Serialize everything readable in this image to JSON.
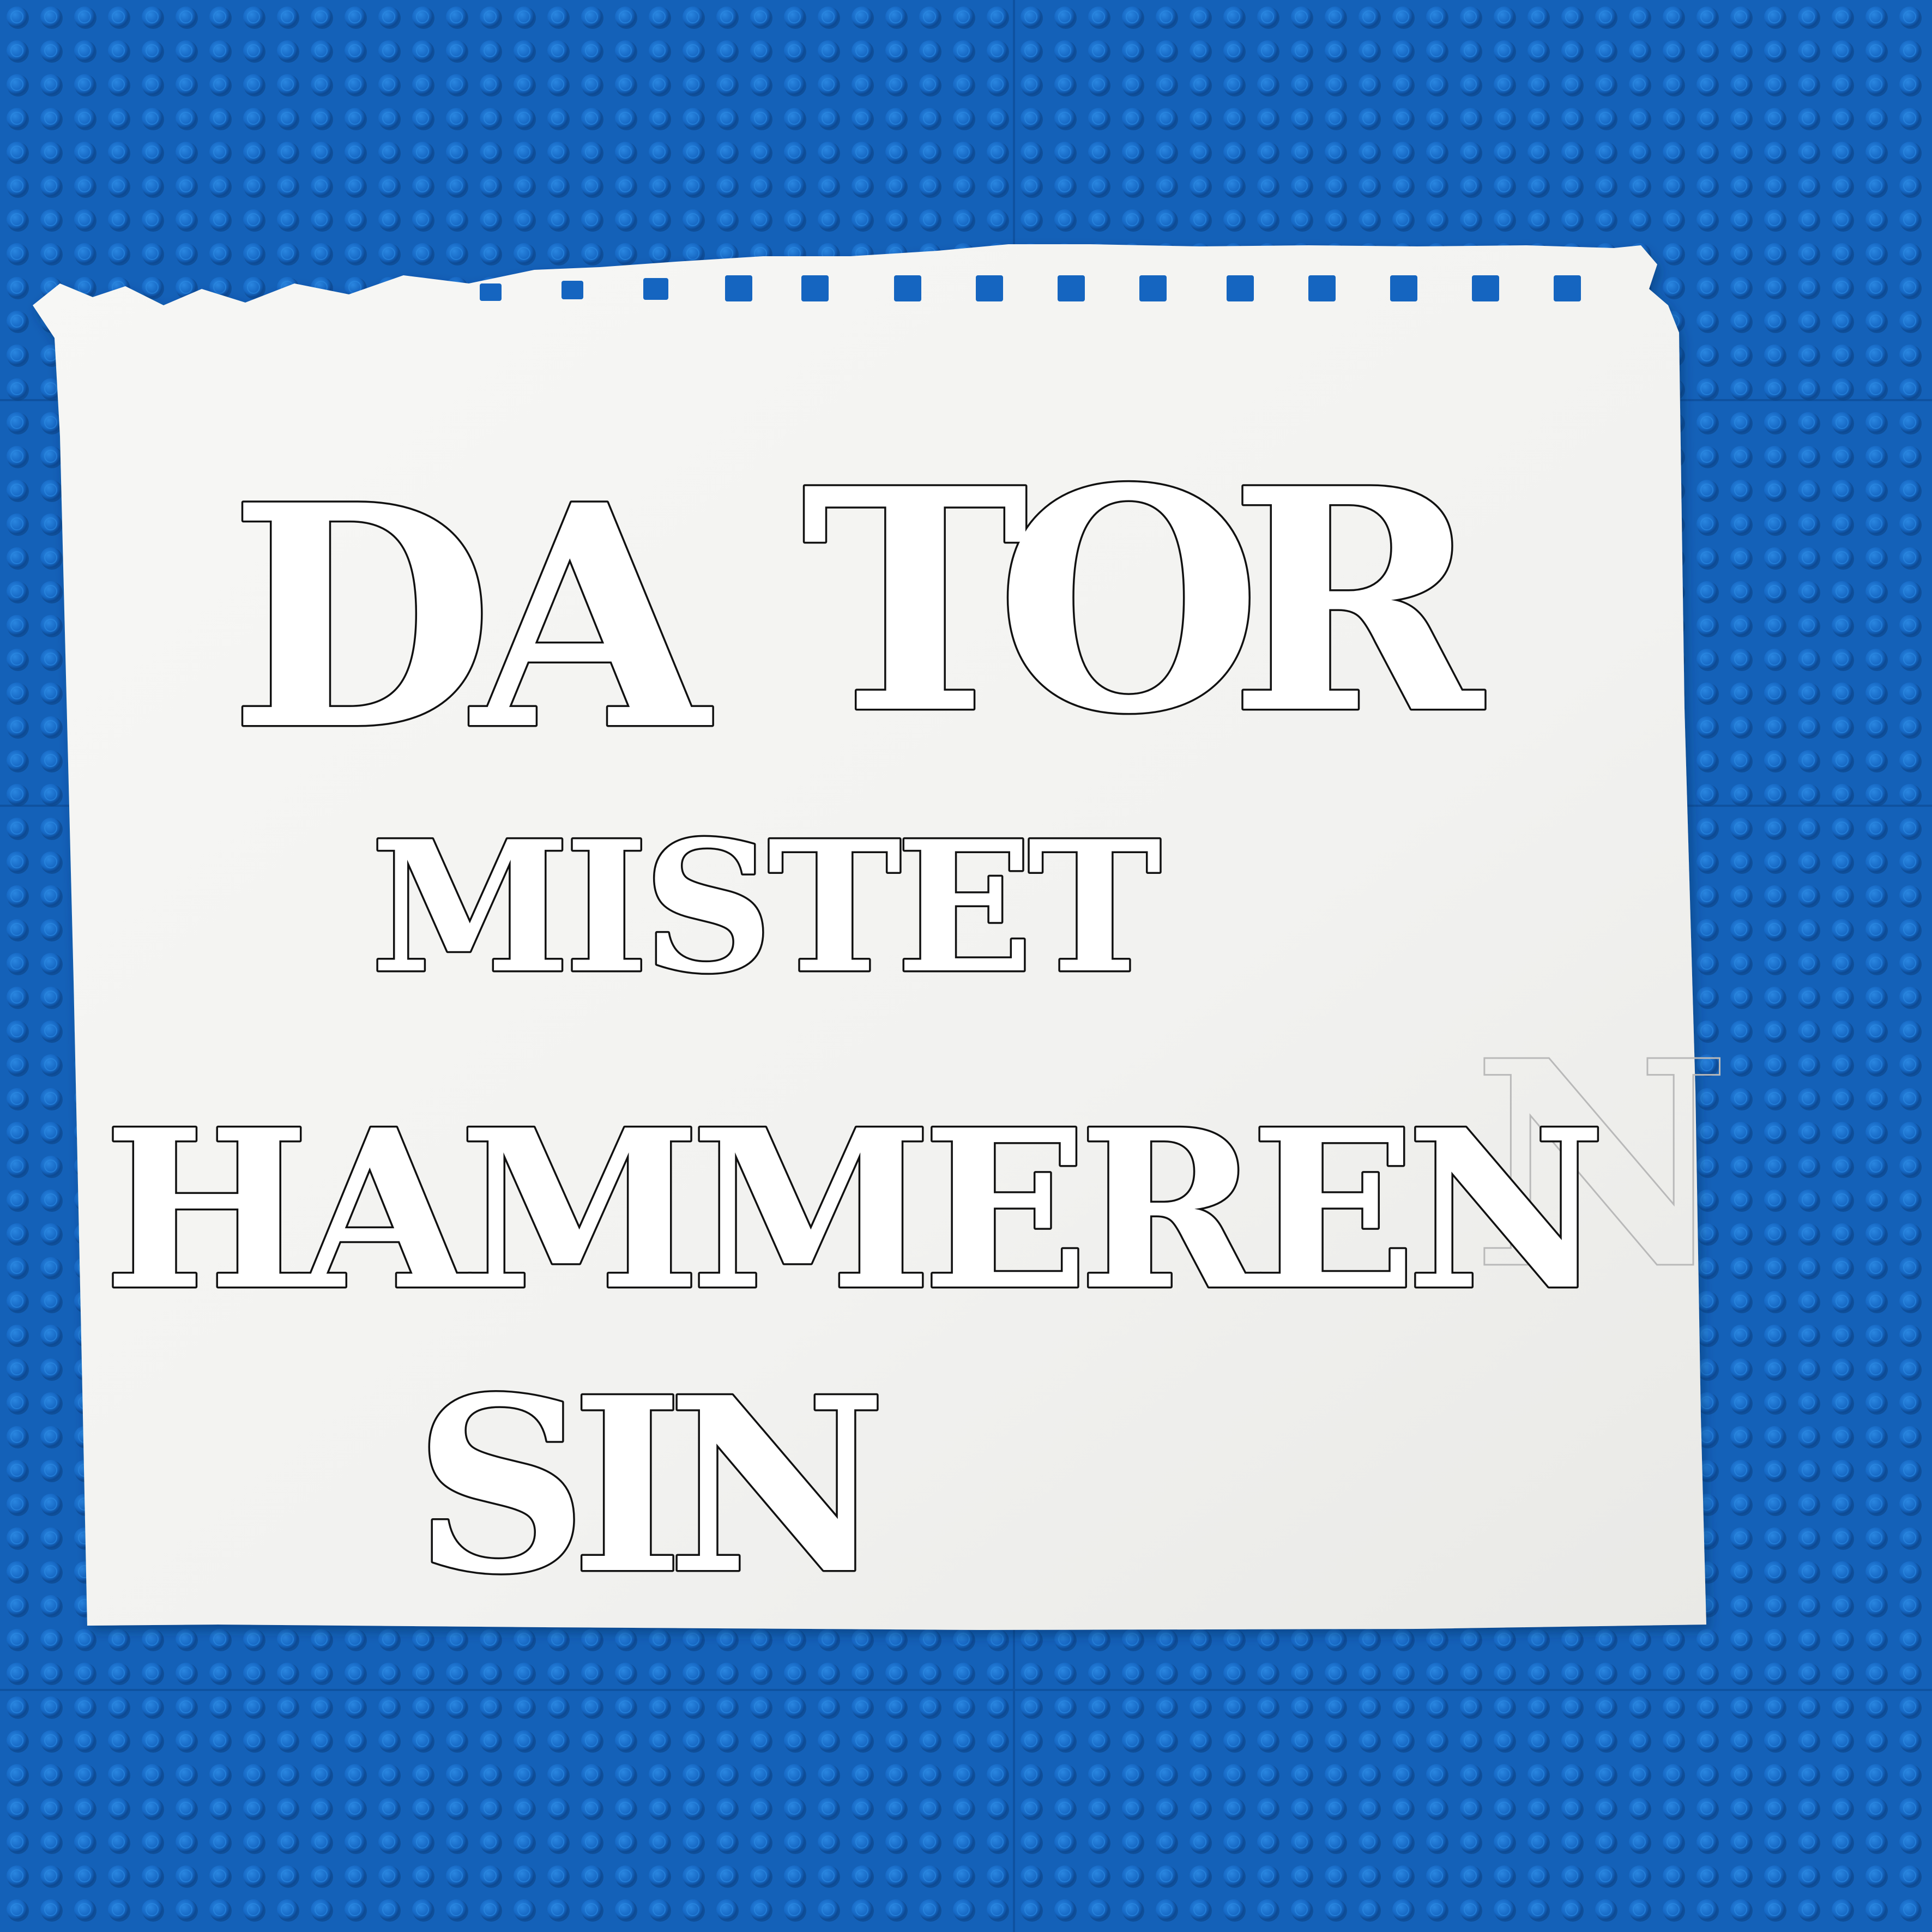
{
  "scene": {
    "description_type": "photo",
    "background": {
      "name": "blue-lego-baseplate",
      "color": "#1565c0",
      "stud_color": "#1a73d1",
      "stud_shadow": "#0d4a94"
    },
    "paper": {
      "color": "#f3f3f1",
      "spiral_hole_color": "#1565c0"
    },
    "lettering": {
      "line1_word1": "DA",
      "line1_word2": "TOR",
      "line2": "MISTET",
      "line3": "HAMMEREN",
      "line4": "SIN",
      "faded_pencil_letter": "N"
    }
  }
}
